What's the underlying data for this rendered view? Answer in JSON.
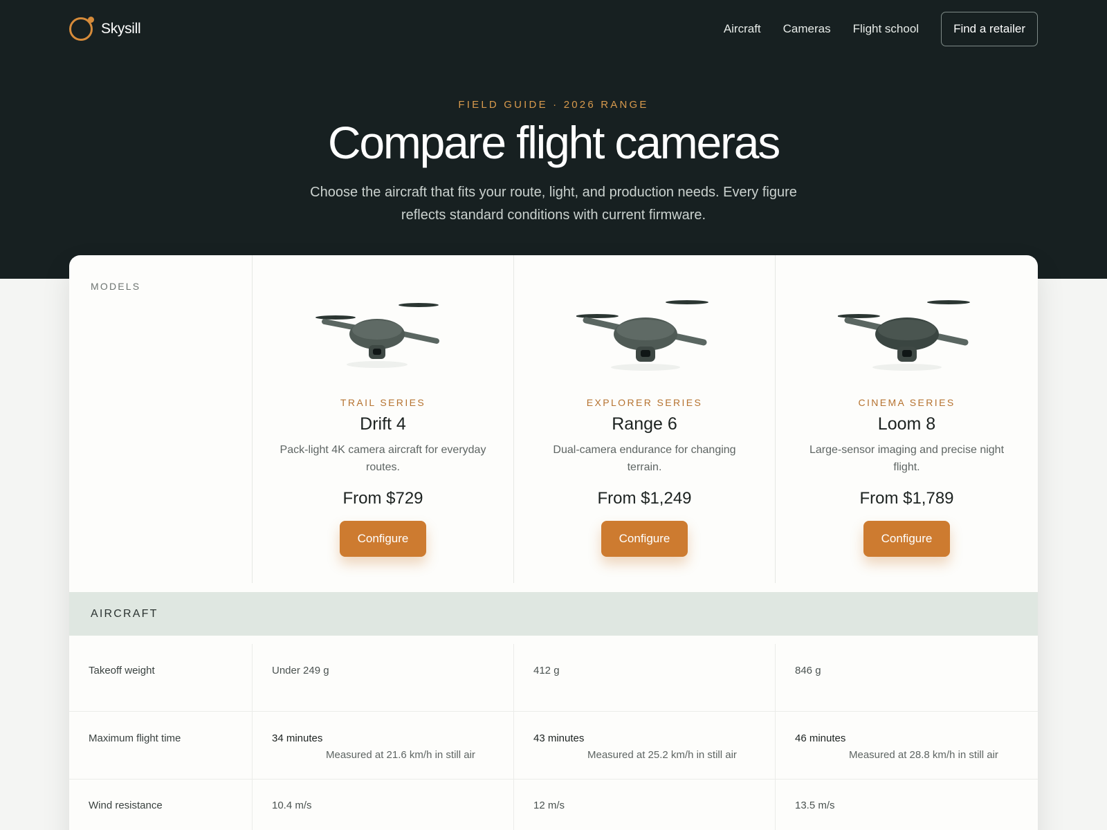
{
  "brand": {
    "name": "Skysill",
    "accent": "#d68b3a"
  },
  "nav": {
    "links": [
      "Aircraft",
      "Cameras",
      "Flight school"
    ],
    "cta": "Find a retailer"
  },
  "hero": {
    "eyebrow": "FIELD GUIDE · 2026 RANGE",
    "title": "Compare flight cameras",
    "subtitle": "Choose the aircraft that fits your route, light, and production needs. Every figure reflects standard conditions with current firmware."
  },
  "models_label": "MODELS",
  "models": [
    {
      "series": "TRAIL SERIES",
      "name": "Drift 4",
      "description": "Pack-light 4K camera aircraft for everyday routes.",
      "price": "From $729",
      "cta": "Configure"
    },
    {
      "series": "EXPLORER SERIES",
      "name": "Range 6",
      "description": "Dual-camera endurance for changing terrain.",
      "price": "From $1,249",
      "cta": "Configure"
    },
    {
      "series": "CINEMA SERIES",
      "name": "Loom 8",
      "description": "Large-sensor imaging and precise night flight.",
      "price": "From $1,789",
      "cta": "Configure"
    }
  ],
  "section": {
    "title": "AIRCRAFT"
  },
  "specs": [
    {
      "label": "Takeoff weight",
      "values": [
        {
          "value": "Under 249 g"
        },
        {
          "value": "412 g"
        },
        {
          "value": "846 g"
        }
      ]
    },
    {
      "label": "Maximum flight time",
      "values": [
        {
          "value": "34 minutes",
          "note": "Measured at 21.6 km/h in still air"
        },
        {
          "value": "43 minutes",
          "note": "Measured at 25.2 km/h in still air"
        },
        {
          "value": "46 minutes",
          "note": "Measured at 28.8 km/h in still air"
        }
      ]
    },
    {
      "label": "Wind resistance",
      "values": [
        {
          "value": "10.4 m/s"
        },
        {
          "value": "12 m/s"
        },
        {
          "value": "13.5 m/s"
        }
      ]
    }
  ],
  "colors": {
    "header_bg": "#172021",
    "button": "#cd7b30",
    "section_band": "#dfe7e1"
  }
}
